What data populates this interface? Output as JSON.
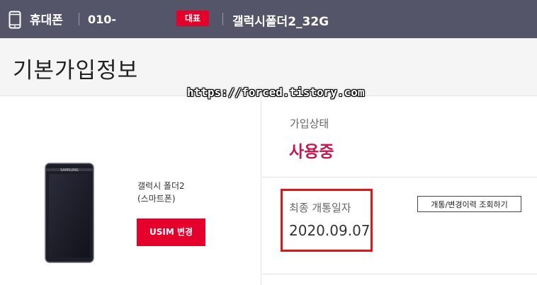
{
  "header": {
    "category": "휴대폰",
    "phone_number": "010-",
    "badge": "대표",
    "model": "갤럭시폴더2_32G"
  },
  "page": {
    "title": "기본가입정보",
    "watermark": "https://forced.tistory.com"
  },
  "device": {
    "name_line1": "갤럭시 폴더2",
    "name_line2": "(스마트폰)",
    "usim_button": "USIM 변경",
    "brand": "SAMSUNG"
  },
  "subscription": {
    "status_label": "가입상태",
    "status_value": "사용중",
    "open_date_label": "최종 개통일자",
    "open_date": "2020.09.07",
    "history_button": "개통/변경이력 조회하기"
  },
  "colors": {
    "accent": "#e4002b",
    "status": "#c4164f",
    "header_bg": "#55556a",
    "highlight": "#e01616"
  },
  "icons": [
    "phone-icon"
  ]
}
